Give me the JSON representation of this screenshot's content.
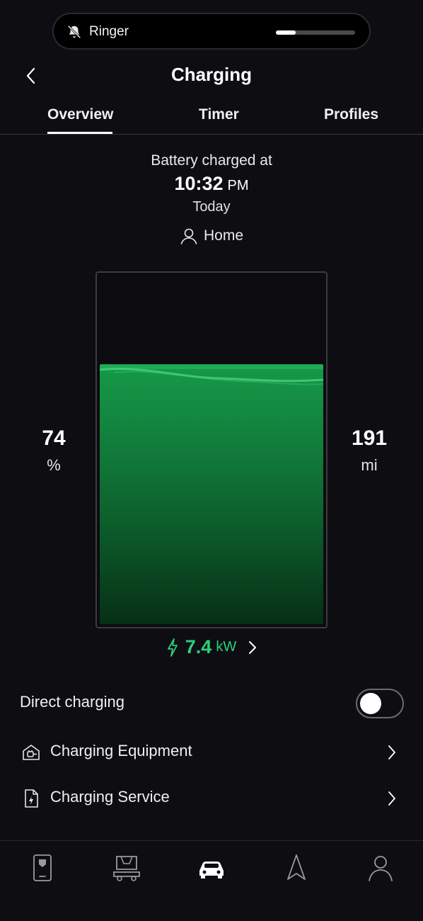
{
  "ringer": {
    "label": "Ringer",
    "icon": "bell-slash-icon",
    "volume_fraction": 0.25
  },
  "header": {
    "title": "Charging",
    "back_icon": "chevron-left-icon"
  },
  "tabs": [
    {
      "label": "Overview",
      "active": true
    },
    {
      "label": "Timer",
      "active": false
    },
    {
      "label": "Profiles",
      "active": false
    }
  ],
  "charge": {
    "status_text": "Battery charged at",
    "time": "10:32",
    "ampm": "PM",
    "day": "Today",
    "location": "Home",
    "location_icon": "person-icon"
  },
  "battery": {
    "level_fraction": 0.74,
    "percent_value": "74",
    "percent_unit": "%",
    "range_value": "191",
    "range_unit": "mi",
    "fill_color": "#159a48"
  },
  "power": {
    "value": "7.4",
    "unit": "kW",
    "color": "#2bcf7e"
  },
  "direct_charging": {
    "label": "Direct charging",
    "enabled": false
  },
  "rows": [
    {
      "label": "Charging Equipment",
      "icon": "charging-equipment-icon"
    },
    {
      "label": "Charging Service",
      "icon": "charging-service-icon"
    }
  ],
  "bottom_nav": [
    {
      "icon": "phone-key-icon",
      "active": false
    },
    {
      "icon": "car-interior-icon",
      "active": false
    },
    {
      "icon": "car-icon",
      "active": true
    },
    {
      "icon": "navigation-icon",
      "active": false
    },
    {
      "icon": "profile-icon",
      "active": false
    }
  ]
}
